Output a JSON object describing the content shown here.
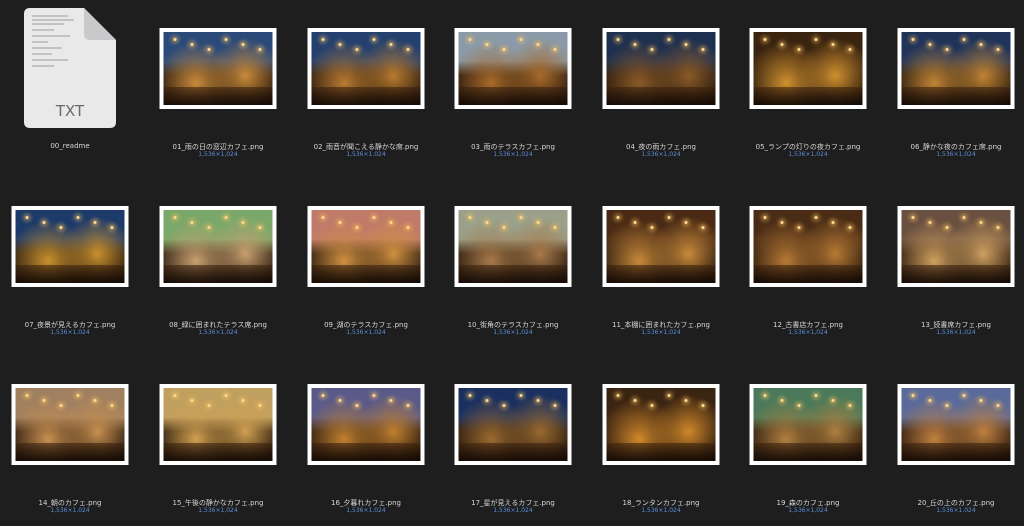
{
  "readme": {
    "name": "00_readme",
    "type_label": "TXT"
  },
  "files": [
    {
      "name": "01_雨の日の窓辺カフェ.png",
      "dims": "1,536×1,024",
      "sky": "#2b4a7a",
      "warm": "#c88a3a"
    },
    {
      "name": "02_雨音が聞こえる静かな席.png",
      "dims": "1,536×1,024",
      "sky": "#23406e",
      "warm": "#b87a30"
    },
    {
      "name": "03_雨のテラスカフェ.png",
      "dims": "1,536×1,024",
      "sky": "#8a9aa8",
      "warm": "#a86a2a"
    },
    {
      "name": "04_夜の雨カフェ.png",
      "dims": "1,536×1,024",
      "sky": "#1e3050",
      "warm": "#8a5a28"
    },
    {
      "name": "05_ランプの灯りの夜カフェ.png",
      "dims": "1,536×1,024",
      "sky": "#3a2410",
      "warm": "#d0902e"
    },
    {
      "name": "06_静かな夜のカフェ席.png",
      "dims": "1,536×1,024",
      "sky": "#20345a",
      "warm": "#c08434"
    },
    {
      "name": "07_夜景が見えるカフェ.png",
      "dims": "1,536×1,024",
      "sky": "#1c3a6a",
      "warm": "#c8902e"
    },
    {
      "name": "08_緑に囲まれたテラス席.png",
      "dims": "1,536×1,024",
      "sky": "#7aa86a",
      "warm": "#c8a070"
    },
    {
      "name": "09_湖のテラスカフェ.png",
      "dims": "1,536×1,024",
      "sky": "#c07a6a",
      "warm": "#d09040"
    },
    {
      "name": "10_街角のテラスカフェ.png",
      "dims": "1,536×1,024",
      "sky": "#9aa08a",
      "warm": "#a87a4a"
    },
    {
      "name": "11_本棚に囲まれたカフェ.png",
      "dims": "1,536×1,024",
      "sky": "#4a2a14",
      "warm": "#c88a3a"
    },
    {
      "name": "12_古書店カフェ.png",
      "dims": "1,536×1,024",
      "sky": "#4a2c16",
      "warm": "#b87a34"
    },
    {
      "name": "13_読書席カフェ.png",
      "dims": "1,536×1,024",
      "sky": "#6a5040",
      "warm": "#d0a060"
    },
    {
      "name": "14_朝のカフェ.png",
      "dims": "1,536×1,024",
      "sky": "#a08060",
      "warm": "#c89050"
    },
    {
      "name": "15_午後の静かなカフェ.png",
      "dims": "1,536×1,024",
      "sky": "#c0a060",
      "warm": "#d0a050"
    },
    {
      "name": "16_夕暮れカフェ.png",
      "dims": "1,536×1,024",
      "sky": "#5a5a8a",
      "warm": "#c08030"
    },
    {
      "name": "17_星が見えるカフェ.png",
      "dims": "1,536×1,024",
      "sky": "#1a3060",
      "warm": "#9a6a30"
    },
    {
      "name": "18_ランタンカフェ.png",
      "dims": "1,536×1,024",
      "sky": "#3a2412",
      "warm": "#d0882a"
    },
    {
      "name": "19_森のカフェ.png",
      "dims": "1,536×1,024",
      "sky": "#4a7a5a",
      "warm": "#b08040"
    },
    {
      "name": "20_丘の上のカフェ.png",
      "dims": "1,536×1,024",
      "sky": "#5a6a9a",
      "warm": "#c08040"
    }
  ]
}
